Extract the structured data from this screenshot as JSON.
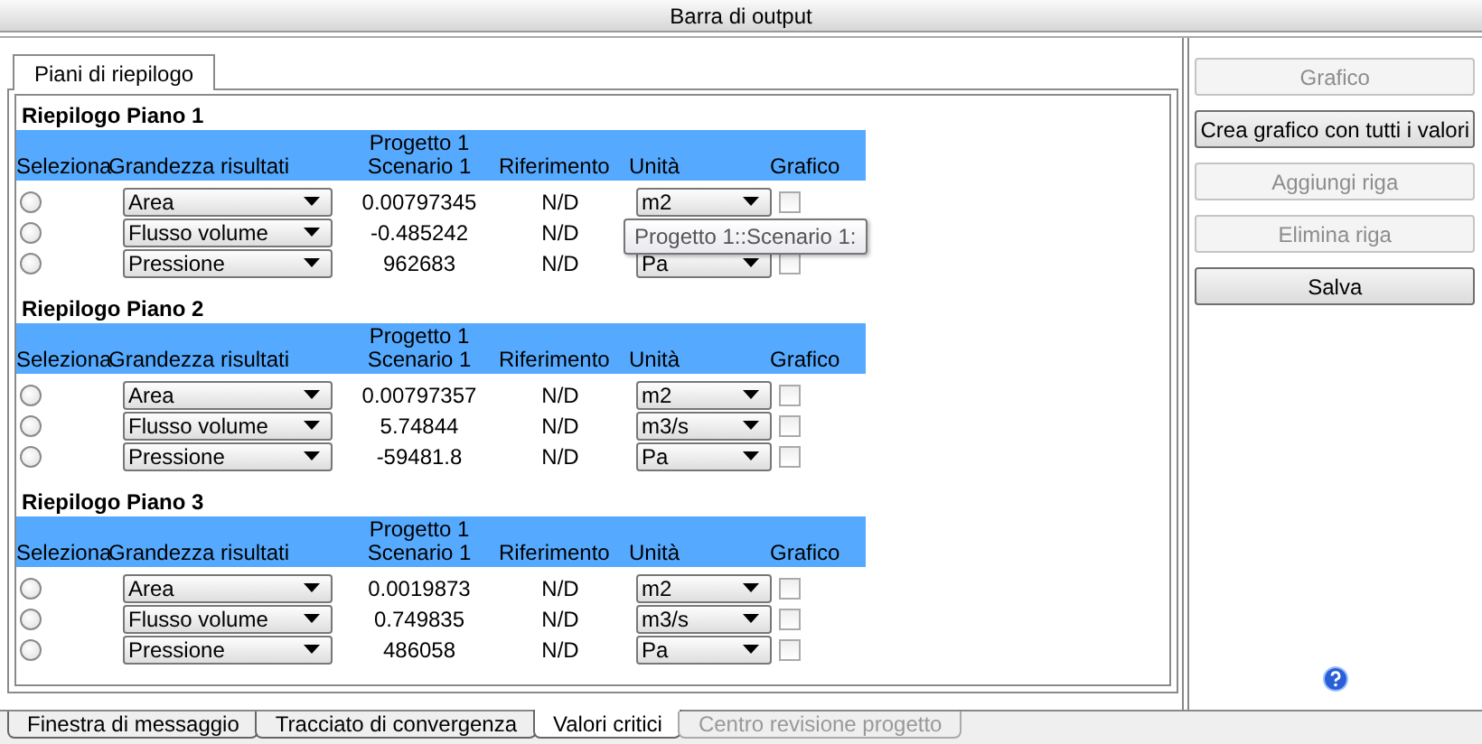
{
  "window": {
    "title": "Barra di output"
  },
  "tabs": [
    {
      "label": "Piani di riepilogo",
      "selected": true
    }
  ],
  "sections": [
    {
      "title": "Riepilogo Piano 1",
      "columns": [
        "Seleziona",
        "Grandezza risultati",
        "Progetto 1\nScenario 1",
        "Riferimento",
        "Unità",
        "Grafico"
      ],
      "rows": [
        {
          "selected": false,
          "quantity": "Area",
          "value": "0.00797345",
          "reference": "N/D",
          "unit": "m2",
          "chart": false
        },
        {
          "selected": false,
          "quantity": "Flusso volume",
          "value": "-0.485242",
          "reference": "N/D"
        },
        {
          "selected": false,
          "quantity": "Pressione",
          "value": "962683",
          "reference": "N/D",
          "unit": "Pa",
          "chart": false
        }
      ],
      "tooltip": "Progetto 1::Scenario 1:"
    },
    {
      "title": "Riepilogo Piano 2",
      "columns": [
        "Seleziona",
        "Grandezza risultati",
        "Progetto 1\nScenario 1",
        "Riferimento",
        "Unità",
        "Grafico"
      ],
      "rows": [
        {
          "selected": false,
          "quantity": "Area",
          "value": "0.00797357",
          "reference": "N/D",
          "unit": "m2",
          "chart": false
        },
        {
          "selected": false,
          "quantity": "Flusso volume",
          "value": "5.74844",
          "reference": "N/D",
          "unit": "m3/s",
          "chart": false
        },
        {
          "selected": false,
          "quantity": "Pressione",
          "value": "-59481.8",
          "reference": "N/D",
          "unit": "Pa",
          "chart": false
        }
      ]
    },
    {
      "title": "Riepilogo Piano 3",
      "columns": [
        "Seleziona",
        "Grandezza risultati",
        "Progetto 1\nScenario 1",
        "Riferimento",
        "Unità",
        "Grafico"
      ],
      "rows": [
        {
          "selected": false,
          "quantity": "Area",
          "value": "0.0019873",
          "reference": "N/D",
          "unit": "m2",
          "chart": false
        },
        {
          "selected": false,
          "quantity": "Flusso volume",
          "value": "0.749835",
          "reference": "N/D",
          "unit": "m3/s",
          "chart": false
        },
        {
          "selected": false,
          "quantity": "Pressione",
          "value": "486058",
          "reference": "N/D",
          "unit": "Pa",
          "chart": false
        }
      ]
    }
  ],
  "buttons": [
    {
      "label": "Grafico",
      "disabled": true
    },
    {
      "label": "Crea grafico con tutti i valori",
      "disabled": false
    },
    {
      "label": "Aggiungi riga",
      "disabled": true
    },
    {
      "label": "Elimina riga",
      "disabled": true
    },
    {
      "label": "Salva",
      "disabled": false
    }
  ],
  "bottom_tabs": [
    {
      "label": "Finestra di messaggio",
      "selected": false,
      "disabled": false
    },
    {
      "label": "Tracciato di convergenza",
      "selected": false,
      "disabled": false
    },
    {
      "label": "Valori critici",
      "selected": true,
      "disabled": false
    },
    {
      "label": "Centro revisione progetto",
      "selected": false,
      "disabled": true
    }
  ]
}
